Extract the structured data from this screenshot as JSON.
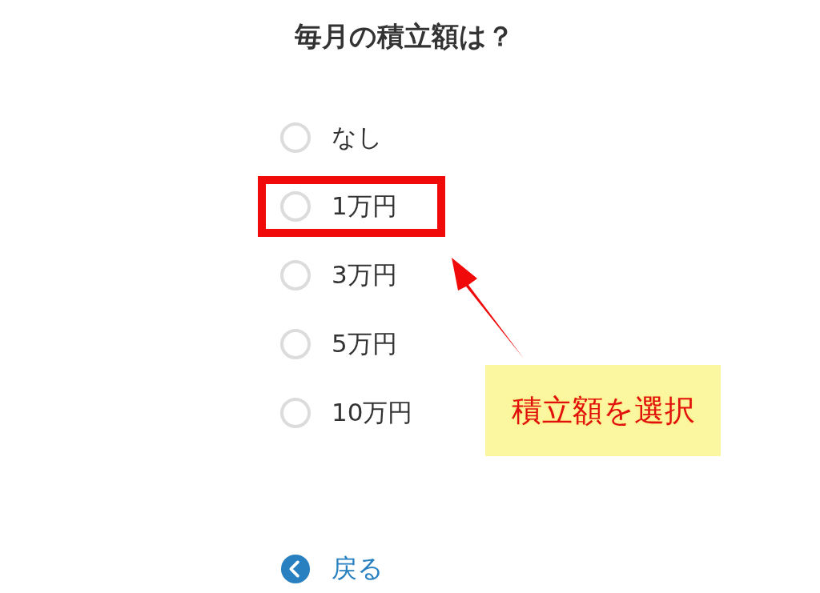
{
  "title": "毎月の積立額は？",
  "options": [
    {
      "label": "なし",
      "selected": false,
      "highlighted": false
    },
    {
      "label": "1万円",
      "selected": false,
      "highlighted": true
    },
    {
      "label": "3万円",
      "selected": false,
      "highlighted": false
    },
    {
      "label": "5万円",
      "selected": false,
      "highlighted": false
    },
    {
      "label": "10万円",
      "selected": false,
      "highlighted": false
    }
  ],
  "callout": {
    "text": "積立額を選択"
  },
  "back": {
    "label": "戻る"
  }
}
